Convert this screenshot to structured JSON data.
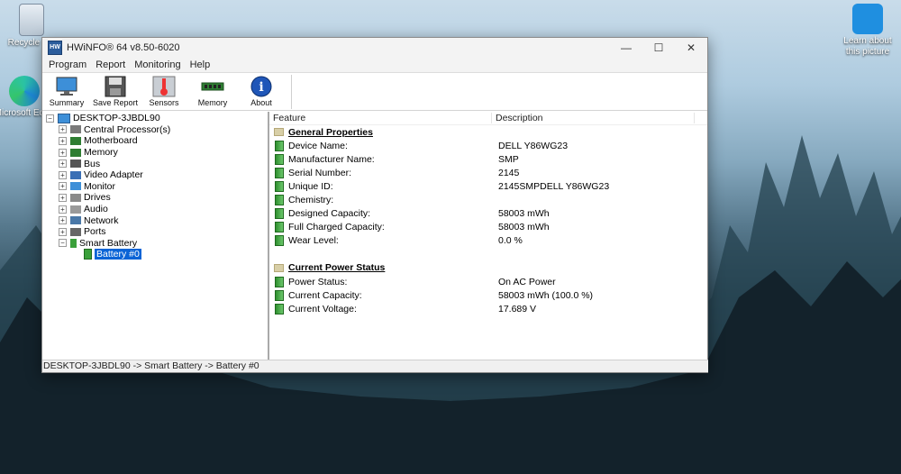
{
  "desktop": {
    "recycle_bin_label": "Recycle Bin",
    "edge_label": "Microsoft Edge",
    "learn_label": "Learn about this picture"
  },
  "window": {
    "title": "HWiNFO® 64 v8.50-6020",
    "menu": [
      "Program",
      "Report",
      "Monitoring",
      "Help"
    ],
    "toolbar": {
      "summary": "Summary",
      "save_report": "Save Report",
      "sensors": "Sensors",
      "memory": "Memory",
      "about": "About"
    }
  },
  "tree": {
    "root": "DESKTOP-3JBDL90",
    "items": [
      {
        "label": "Central Processor(s)",
        "icon": "cpu-icon"
      },
      {
        "label": "Motherboard",
        "icon": "motherboard-icon"
      },
      {
        "label": "Memory",
        "icon": "memory-icon"
      },
      {
        "label": "Bus",
        "icon": "bus-icon"
      },
      {
        "label": "Video Adapter",
        "icon": "video-adapter-icon"
      },
      {
        "label": "Monitor",
        "icon": "monitor-icon"
      },
      {
        "label": "Drives",
        "icon": "drives-icon"
      },
      {
        "label": "Audio",
        "icon": "audio-icon"
      },
      {
        "label": "Network",
        "icon": "network-icon"
      },
      {
        "label": "Ports",
        "icon": "ports-icon"
      },
      {
        "label": "Smart Battery",
        "icon": "battery-icon"
      }
    ],
    "child": "Battery #0"
  },
  "details": {
    "col_feature": "Feature",
    "col_description": "Description",
    "general": {
      "title": "General Properties",
      "rows": [
        {
          "label": "Device Name:",
          "value": "DELL Y86WG23"
        },
        {
          "label": "Manufacturer Name:",
          "value": "SMP"
        },
        {
          "label": "Serial Number:",
          "value": "2145"
        },
        {
          "label": "Unique ID:",
          "value": "2145SMPDELL Y86WG23"
        },
        {
          "label": "Chemistry:",
          "value": ""
        },
        {
          "label": "Designed Capacity:",
          "value": "58003 mWh"
        },
        {
          "label": "Full Charged Capacity:",
          "value": "58003 mWh"
        },
        {
          "label": "Wear Level:",
          "value": "0.0 %"
        }
      ]
    },
    "power": {
      "title": "Current Power Status",
      "rows": [
        {
          "label": "Power Status:",
          "value": "On AC Power"
        },
        {
          "label": "Current Capacity:",
          "value": "58003 mWh (100.0 %)"
        },
        {
          "label": "Current Voltage:",
          "value": "17.689 V"
        }
      ]
    }
  },
  "status_bar": "DESKTOP-3JBDL90 -> Smart Battery -> Battery #0"
}
